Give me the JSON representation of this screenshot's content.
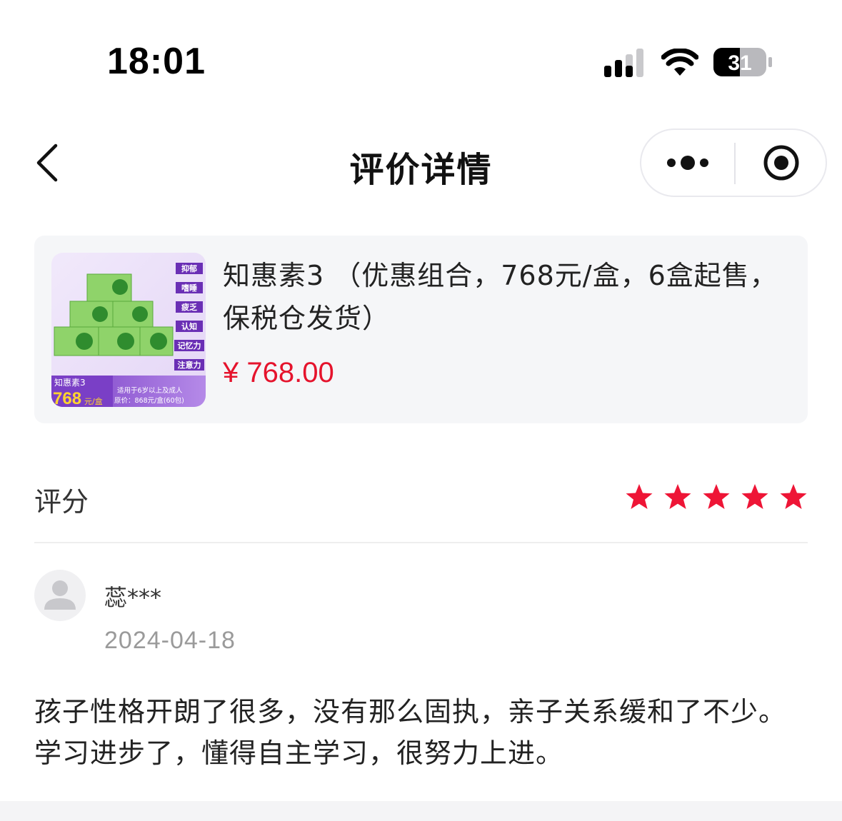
{
  "status_bar": {
    "time": "18:01",
    "battery_level": "31",
    "signal_icon": "cellular-signal-icon",
    "wifi_icon": "wifi-icon",
    "battery_icon": "battery-icon"
  },
  "nav": {
    "title": "评价详情",
    "back_icon": "chevron-left-icon",
    "more_icon": "more-dots-icon",
    "close_icon": "target-close-icon"
  },
  "product": {
    "name": "知惠素3 （优惠组合，768元/盒，6盒起售，保税仓发货）",
    "price": "¥ 768.00",
    "price_color": "#e5132c",
    "image": {
      "tags": [
        "抑郁",
        "嗜睡",
        "疲乏",
        "认知",
        "记忆力",
        "注意力"
      ],
      "badge_name": "知惠素3",
      "badge_price": "768",
      "badge_unit": "元/盒",
      "note_line1": "适用于6岁以上及成人",
      "note_line2": "原价：868元/盒(60包)"
    }
  },
  "rating": {
    "label": "评分",
    "stars": 5,
    "max_stars": 5,
    "star_color": "#ee1536"
  },
  "review": {
    "reviewer_name": "蕊***",
    "date": "2024-04-18",
    "avatar_icon": "user-avatar-icon",
    "text": "孩子性格开朗了很多，没有那么固执，亲子关系缓和了不少。学习进步了，懂得自主学习，很努力上进。"
  }
}
